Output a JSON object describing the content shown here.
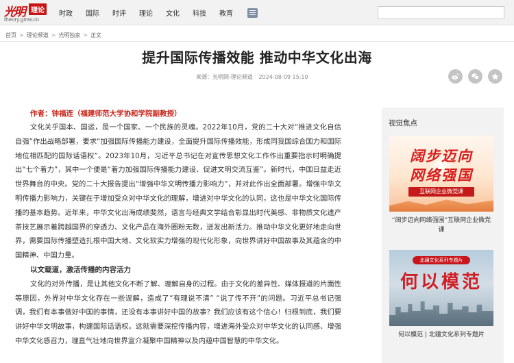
{
  "header": {
    "logo_mark": "光明",
    "logo_box": "理论",
    "logo_url": "theory.gmw.cn",
    "nav": [
      "时政",
      "国际",
      "时评",
      "理论",
      "文化",
      "科技",
      "教育"
    ]
  },
  "breadcrumb": [
    "首页",
    "理论频道",
    "光明独家",
    "正文"
  ],
  "article": {
    "title": "提升国际传播效能 推动中华文化出海",
    "source": "来源：光明网-理论频道",
    "date": "2024-08-09 15:10",
    "author": "作者：钟福连（福建师范大学协和学院副教授）",
    "para1": "文化关乎国本、国运，是一个国家、一个民族的灵魂。2022年10月，党的二十大对“推进文化自信自强”作出战略部署，要求“加强国际传播能力建设，全面提升国际传播效能，形成同我国综合国力和国际地位相匹配的国际话语权”。2023年10月，习近平总书记在对宣传思想文化工作作出重要指示时明确提出“七个着力”，其中一个便是“着力加强国际传播能力建设、促进文明交流互鉴”。新时代，中国日益走近世界舞台的中央。党的二十大报告提出“增强中华文明传播力影响力”，并对此作出全面部署。增强中华文明传播力影响力，关键在于增加受众对中华文化的理解，增进对中华文化的认同，这也是中华文化国际传播的基本趋势。近年来，中华文化出海成绩斐然，语言与经典文学结合彰显出时代美感、非物质文化遗产茶技艺展示着跨越国界的穿透力、文化产品在海外圈粉无数，迸发出新活力。推动中华文化更好地走向世界，需要国际传播塑造扎根中国大地、文化软实力增强的现代化形象，向世界讲好中国故事及其蕴含的中国精神、中国力量。",
    "subhead": "以文载道，激活传播的内容活力",
    "para2": "文化的对外传播，是让其他文化不断了解、理解自身的过程。由于文化的差异性、媒体报道的片面性等原因，外界对中华文化存在一些误解，造成了“有理说不清” “说了传不开”的问题。习近平总书记强调，我们有本事做好中国的事情，还没有本事讲好中国的故事？我们应该有这个信心！归根到底，我们要讲好中华文明故事，构建国际话语权。这就需要深挖传播内容，增进海外受众对中华文化的认同感、增强中华文化感召力，理直气壮地向世界宣介凝聚中国精神以及内蕴中国智慧的中华文化。"
  },
  "sidebar": {
    "title": "视觉焦点",
    "card1": {
      "img_line1": "阔步迈向",
      "img_line2": "网络强国",
      "img_band": "互联网企业微党课",
      "caption": "“阔步迈向网络强国”互联网企业微党课"
    },
    "card2": {
      "img_tag": "北疆文化系列专题片",
      "img_big": "何以模范",
      "caption": "何以模范 | 北疆文化系列专题片"
    }
  },
  "icons": [
    "weibo-icon",
    "wechat-icon",
    "qzone-icon",
    "menu-grid-icon"
  ],
  "colors": {
    "accent": "#c8251c",
    "brand_red": "#c81414",
    "nav_bg": "#f2f2f2",
    "share_bg": "#c4c4c4"
  }
}
